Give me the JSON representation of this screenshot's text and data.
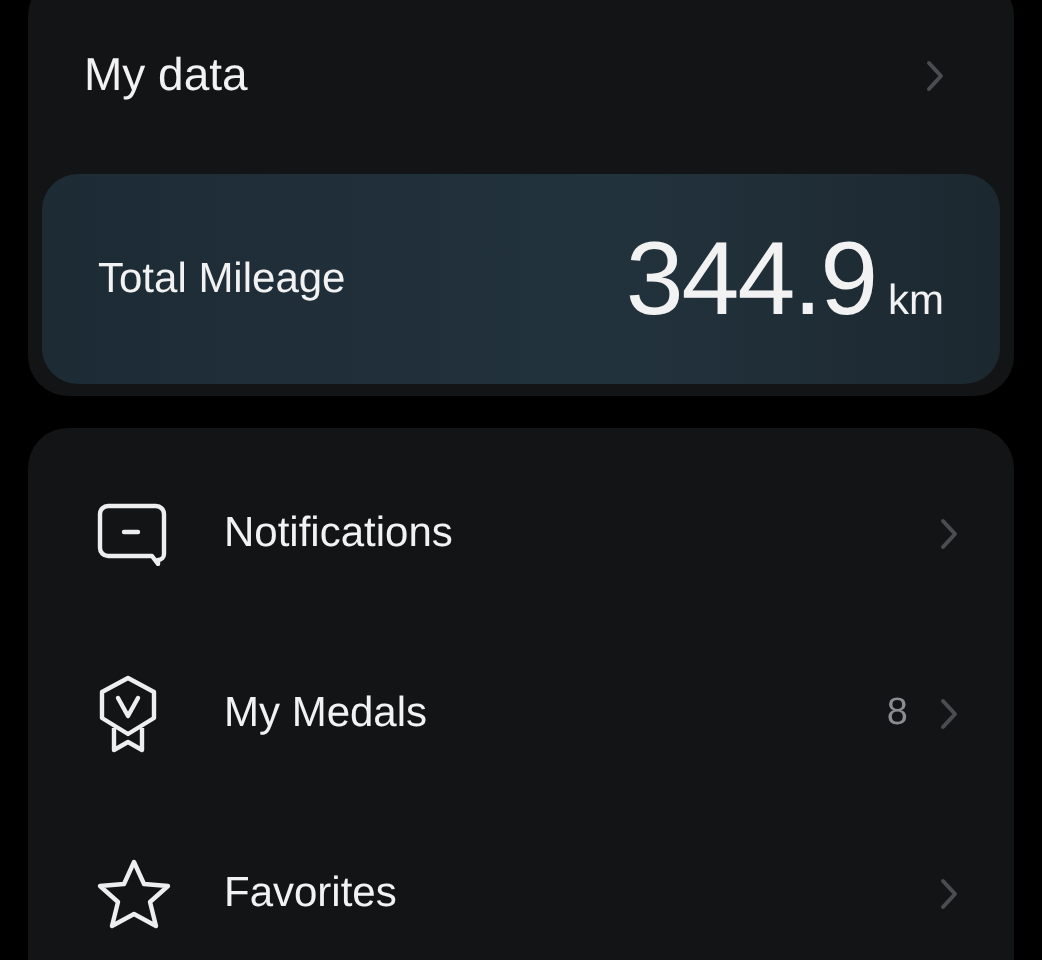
{
  "my_data": {
    "title": "My data",
    "mileage": {
      "label": "Total Mileage",
      "value": "344.9",
      "unit": "km"
    }
  },
  "menu": [
    {
      "kind": "message",
      "label": "Notifications"
    },
    {
      "kind": "medal",
      "label": "My Medals",
      "count": "8"
    },
    {
      "kind": "star",
      "label": "Favorites"
    }
  ]
}
